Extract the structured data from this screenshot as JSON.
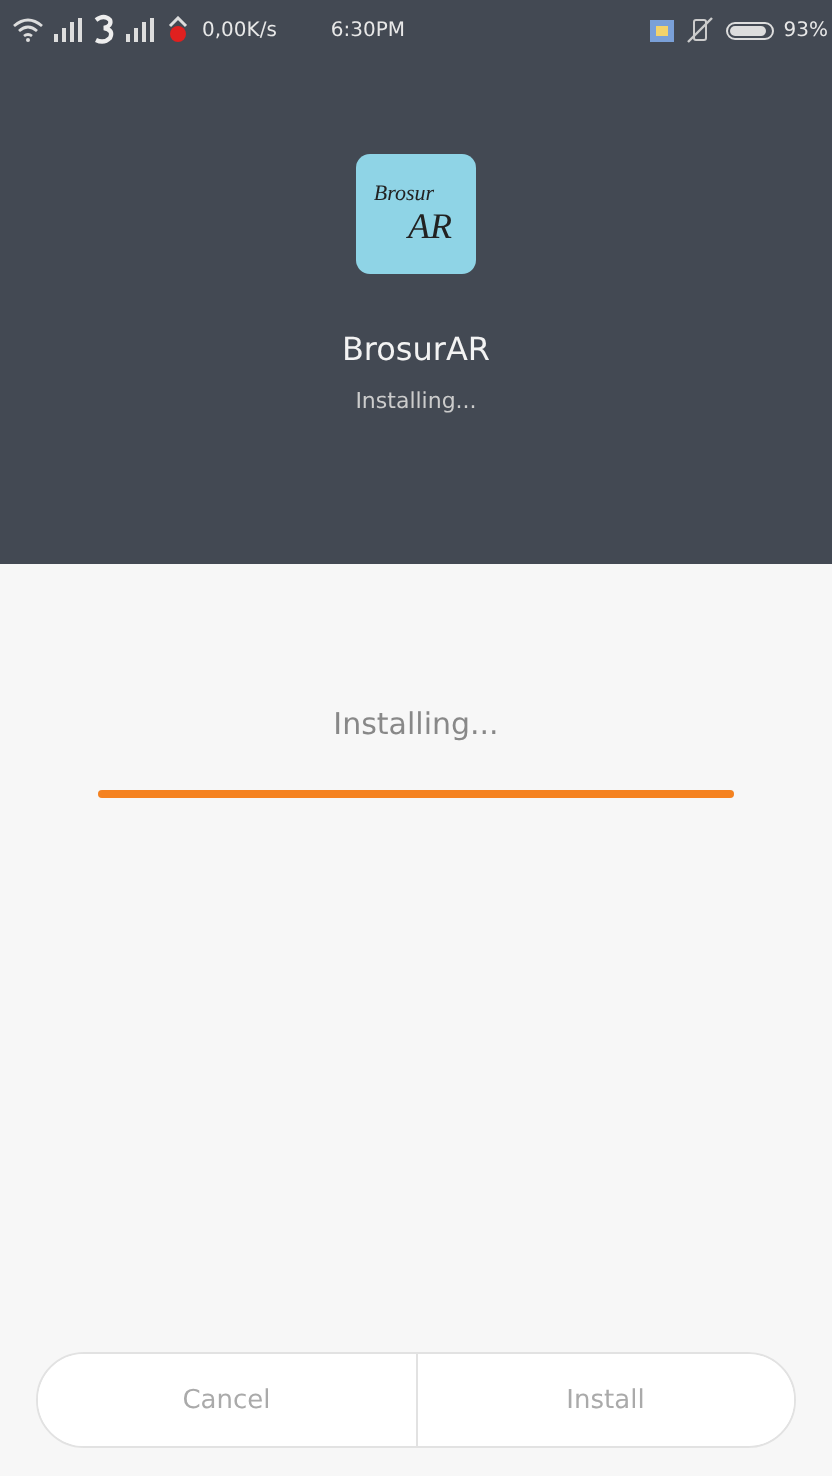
{
  "status_bar": {
    "network_speed": "0,00K/s",
    "time": "6:30PM",
    "battery": "93%"
  },
  "header": {
    "logo_lines": [
      "Brosur",
      "AR"
    ],
    "app_name": "BrosurAR",
    "status": "Installing..."
  },
  "progress": {
    "label": "Installing...",
    "level": 1
  },
  "buttons": [
    {
      "label": "Cancel",
      "disabled": true
    },
    {
      "label": "Install",
      "disabled": true
    }
  ]
}
